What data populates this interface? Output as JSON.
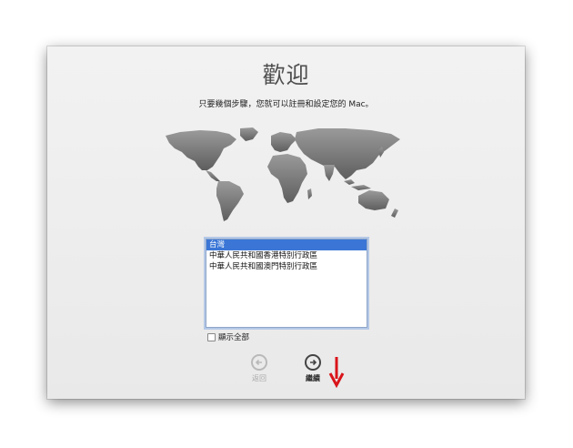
{
  "header": {
    "title": "歡迎",
    "subtitle": "只要幾個步驟，您就可以註冊和設定您的 Mac。"
  },
  "region_list": {
    "items": [
      {
        "label": "台灣",
        "selected": true
      },
      {
        "label": "中華人民共和國香港特別行政區",
        "selected": false
      },
      {
        "label": "中華人民共和國澳門特別行政區",
        "selected": false
      }
    ]
  },
  "show_all": {
    "label": "顯示全部",
    "checked": false
  },
  "buttons": {
    "back_label": "返回",
    "continue_label": "繼續"
  },
  "colors": {
    "selection": "#3b76d6",
    "map": "#7a7a7a",
    "annotation_arrow": "#d9141a"
  },
  "icons": {
    "back": "left-arrow-circle-icon",
    "continue": "right-arrow-circle-icon",
    "annotation": "down-arrow-icon"
  }
}
